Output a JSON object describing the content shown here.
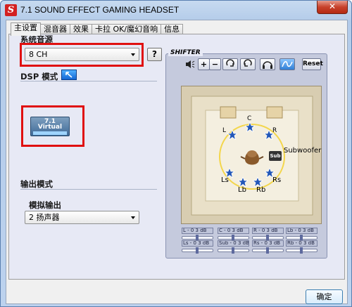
{
  "window": {
    "title": "7.1 SOUND EFFECT GAMING HEADSET",
    "logo_letter": "S",
    "close_glyph": "✕"
  },
  "tabs": [
    {
      "label": "主设置",
      "active": true
    },
    {
      "label": "混音器",
      "active": false
    },
    {
      "label": "效果",
      "active": false
    },
    {
      "label": "卡拉 OK/魔幻音响",
      "active": false
    },
    {
      "label": "信息",
      "active": false
    }
  ],
  "system_source": {
    "label": "系统音源",
    "value": "8 CH",
    "help": "?"
  },
  "dsp": {
    "label": "DSP 模式",
    "toggle_icon": "dsp-toggle-icon",
    "badge_top": "7.1",
    "badge_mid": "Virtual"
  },
  "output": {
    "label": "输出模式",
    "sub_label": "模拟输出",
    "value": "2 扬声器"
  },
  "shifter": {
    "title": "SHIFTER",
    "toolbar": [
      "speaker-icon",
      "plus-icon",
      "minus-icon",
      "rotate-cw-icon",
      "rotate-ccw-icon",
      "headphones-icon",
      "speakers-icon"
    ],
    "reset": "Reset",
    "speakers": {
      "L": "L",
      "C": "C",
      "R": "R",
      "Ls": "Ls",
      "Rs": "Rs",
      "Lb": "Lb",
      "Rb": "Rb",
      "sub": "Sub",
      "sub_label": "Subwoofer"
    },
    "levels": [
      {
        "ch": "L",
        "text": "L  - 0 3 dB"
      },
      {
        "ch": "C",
        "text": "C  - 0 3 dB"
      },
      {
        "ch": "R",
        "text": "R  - 0 3 dB"
      },
      {
        "ch": "Lb",
        "text": "Lb  - 0 3 dB"
      },
      {
        "ch": "Ls",
        "text": "Ls  - 0 3 dB"
      },
      {
        "ch": "Sub",
        "text": "Sub - 0 3 dB"
      },
      {
        "ch": "Rs",
        "text": "Rs  - 0 3 dB"
      },
      {
        "ch": "Rb",
        "text": "Rb  - 0 3 dB"
      }
    ]
  },
  "footer": {
    "ok": "确定"
  },
  "colors": {
    "highlight_box": "#e01010",
    "accent_blue": "#1467d4"
  }
}
